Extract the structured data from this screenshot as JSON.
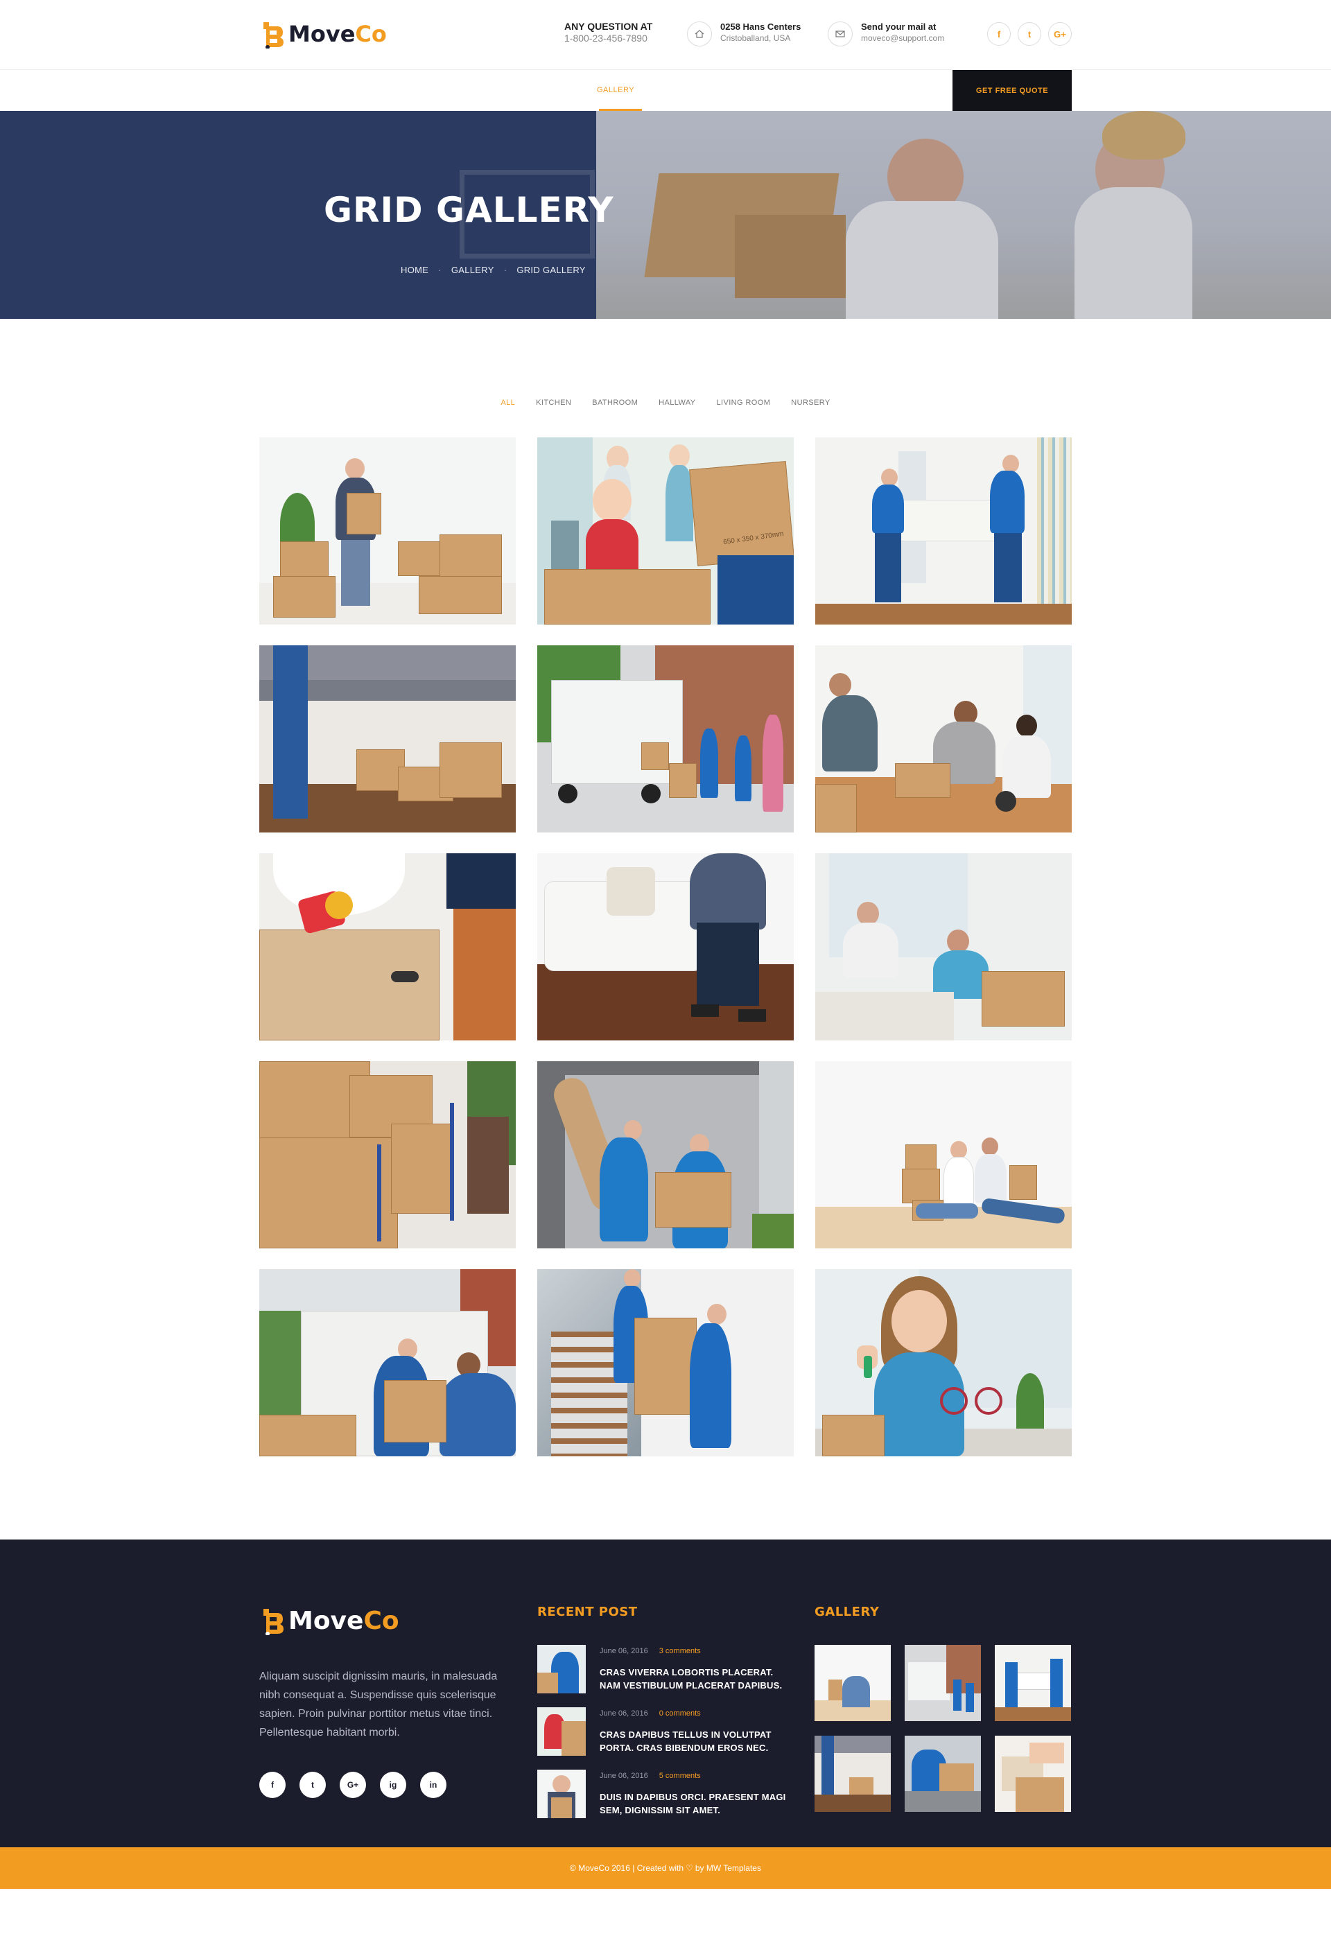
{
  "brand": {
    "name_a": "Move",
    "name_b": "Co"
  },
  "header": {
    "contact": {
      "title": "ANY QUESTION AT",
      "value": "1-800-23-456-7890"
    },
    "address": {
      "title": "0258 Hans Centers",
      "value": "Cristoballand, USA"
    },
    "mail": {
      "title": "Send your mail at",
      "value": "moveco@support.com"
    },
    "socials": [
      "f",
      "t",
      "G+"
    ]
  },
  "nav": {
    "items": [
      "GALLERY"
    ],
    "active": "GALLERY",
    "cta": "GET FREE QUOTE"
  },
  "banner": {
    "title": "GRID GALLERY",
    "breadcrumb": [
      "HOME",
      "GALLERY",
      "GRID GALLERY"
    ],
    "separator": "·"
  },
  "gallery": {
    "filters": [
      "ALL",
      "KITCHEN",
      "BATHROOM",
      "HALLWAY",
      "LIVING ROOM",
      "NURSERY"
    ],
    "active_filter": "ALL",
    "box_label": "650 x 350 x 370mm",
    "items": [
      "man-carrying-boxes-with-plant",
      "girl-in-moving-box",
      "movers-carrying-white-sofa",
      "movers-lifting-grey-sofa",
      "moving-truck-unloading",
      "family-packing-living-room",
      "woman-taping-box",
      "man-lifting-white-couch",
      "couple-unpacking-boxes",
      "boxes-on-hand-trucks",
      "movers-unloading-van",
      "couple-sitting-on-floor",
      "movers-truck-handoff",
      "movers-on-stairs",
      "woman-holding-keys"
    ]
  },
  "footer": {
    "about": "Aliquam suscipit dignissim mauris, in malesuada nibh consequat a. Suspendisse quis scelerisque sapien. Proin pulvinar porttitor metus vitae tinci. Pellentesque habitant morbi.",
    "socials": [
      "f",
      "t",
      "G+",
      "ig",
      "in"
    ],
    "recent_title": "RECENT POST",
    "posts": [
      {
        "date": "June 06, 2016",
        "comments": "3 comments",
        "title": "CRAS VIVERRA LOBORTIS PLACERAT. NAM VESTIBULUM PLACERAT DAPIBUS."
      },
      {
        "date": "June 06, 2016",
        "comments": "0 comments",
        "title": "CRAS DAPIBUS TELLUS IN VOLUTPAT PORTA. CRAS BIBENDUM EROS NEC."
      },
      {
        "date": "June 06, 2016",
        "comments": "5 comments",
        "title": "DUIS IN DAPIBUS ORCI. PRAESENT MAGI SEM, DIGNISSIM SIT AMET."
      }
    ],
    "gallery_title": "GALLERY",
    "copyright_a": "© MoveCo 2016 | Created with",
    "copyright_heart": "♡",
    "copyright_b": "by MW Templates"
  },
  "colors": {
    "accent": "#f39c22",
    "navy": "#2b3a60",
    "footer_bg": "#1c1d2c",
    "dark_btn": "#121319"
  }
}
